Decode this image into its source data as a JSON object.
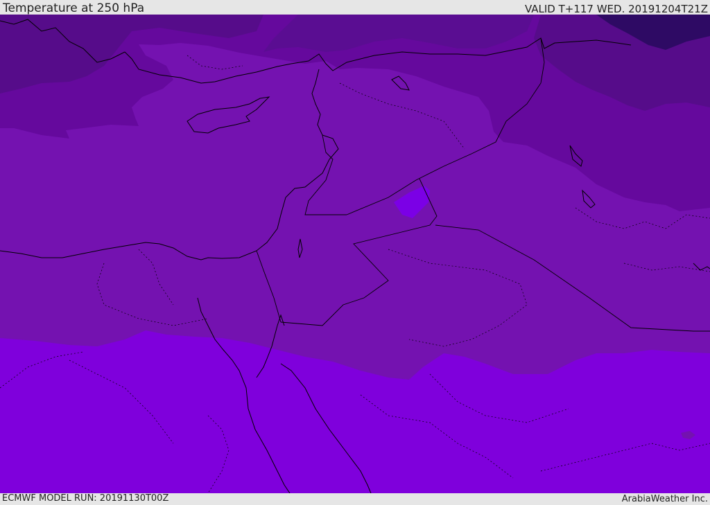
{
  "header": {
    "title": "Temperature at 250 hPa",
    "valid": "VALID T+117 WED. 20191204T21Z"
  },
  "footer": {
    "model_run": "ECMWF MODEL RUN: 20191130T00Z",
    "credit": "ArabiaWeather Inc."
  },
  "map": {
    "field": "temperature",
    "level": "250 hPa",
    "colors": {
      "coldest": "#2e0a64",
      "very_cold": "#560c8a",
      "cold": "#65099d",
      "mid": "#7412b0",
      "warm": "#7f00dc",
      "accent": "#7b00e6",
      "borders": "#000000"
    }
  }
}
